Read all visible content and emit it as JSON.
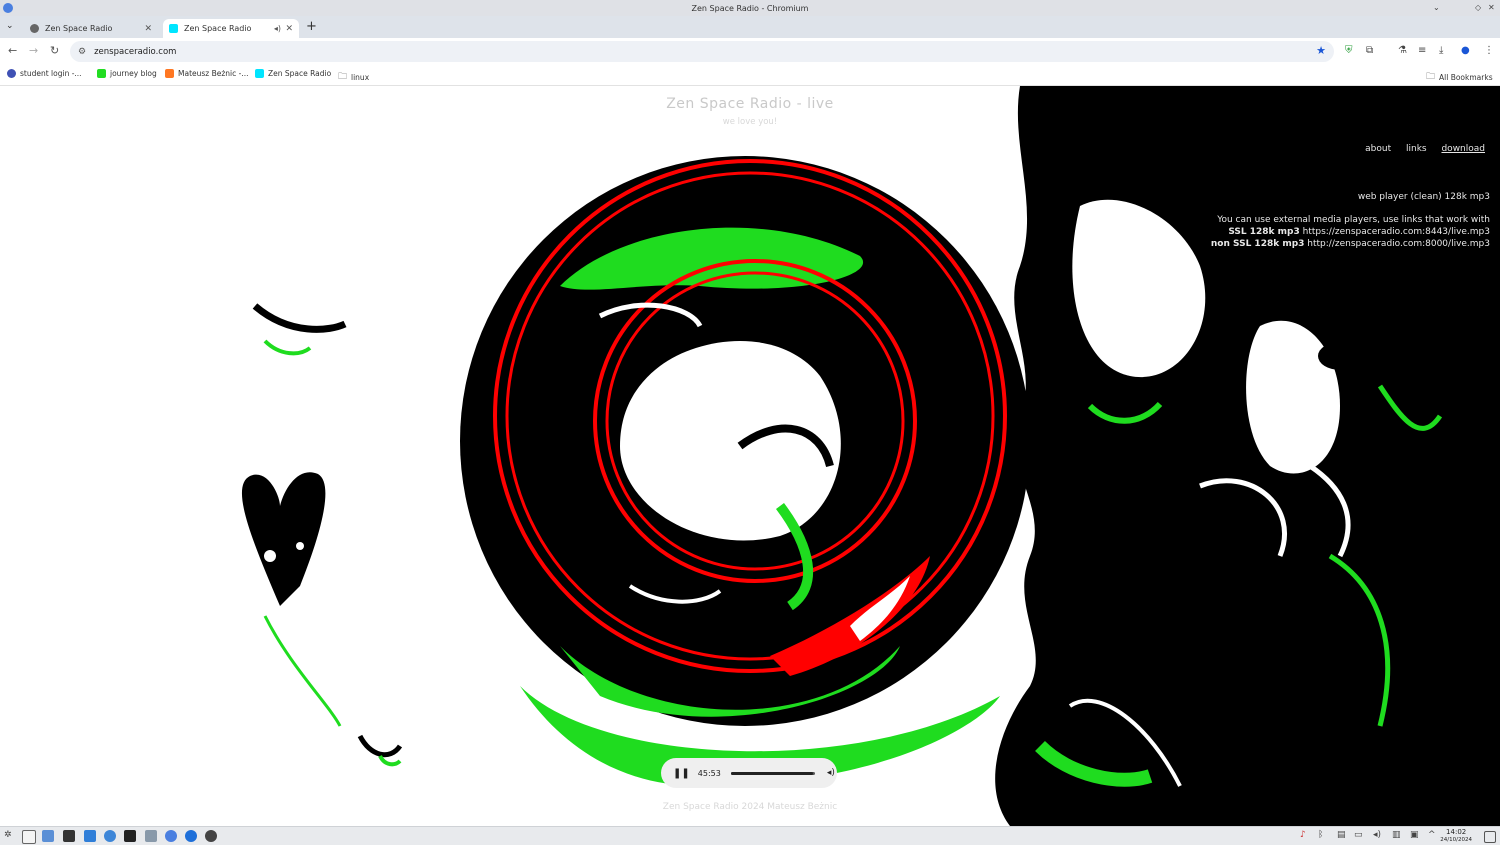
{
  "window": {
    "title": "Zen Space Radio - Chromium"
  },
  "tabs": [
    {
      "label": "Zen Space Radio",
      "favicon_color": "#555555",
      "active": false
    },
    {
      "label": "Zen Space Radio",
      "favicon_color": "#00e5ff",
      "active": true,
      "audio": true
    }
  ],
  "toolbar": {
    "url": "zenspaceradio.com"
  },
  "bookmarks": [
    {
      "label": "student login -...",
      "icon_color": "#3f51b5"
    },
    {
      "label": "journey blog",
      "icon_color": "#22dd22"
    },
    {
      "label": "Mateusz Beżnic -...",
      "icon_color": "#ff7722"
    },
    {
      "label": "Zen Space Radio",
      "icon_color": "#00e5ff"
    },
    {
      "label": "linux",
      "icon": "folder-icon"
    }
  ],
  "all_bookmarks": "All Bookmarks",
  "site": {
    "title": "Zen Space Radio - live",
    "subtitle": "we love you!",
    "nav": [
      "about",
      "links",
      "download"
    ],
    "web_player": "web player (clean) 128k mp3",
    "info_line": "You can use external media players, use links that work with",
    "ssl_label": "SSL 128k mp3",
    "ssl_url": "https://zenspaceradio.com:8443/live.mp3",
    "nonssl_label": "non SSL 128k mp3",
    "nonssl_url": "http://zenspaceradio.com:8000/live.mp3",
    "footer": "Zen Space Radio 2024 Mateusz Beżnic"
  },
  "player": {
    "time": "45:53",
    "progress": 0.98
  },
  "taskbar": {
    "time": "14:02",
    "date": "24/10/2024"
  }
}
